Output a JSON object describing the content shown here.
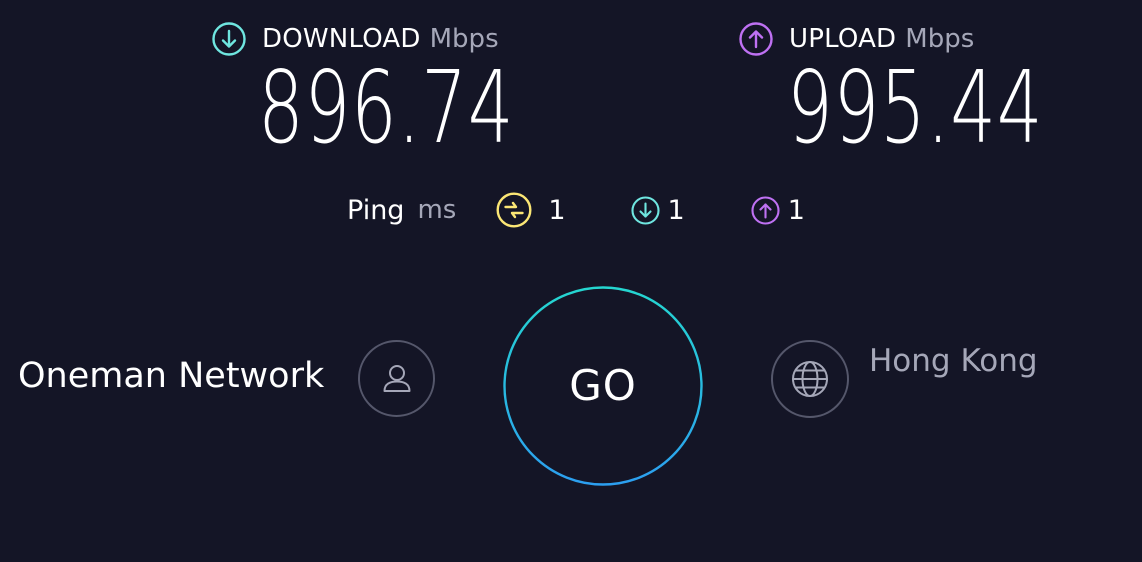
{
  "colors": {
    "background": "#141526",
    "download_accent": "#6fe6e0",
    "upload_accent": "#bf71f3",
    "ping_idle_accent": "#fbe675",
    "go_ring_start": "#25d6d0",
    "go_ring_end": "#2c9ff0",
    "muted_text": "#a5a7b8",
    "icon_outline": "#55576b"
  },
  "download": {
    "icon": "download-arrow-icon",
    "label": "DOWNLOAD",
    "unit": "Mbps",
    "value": "896.74"
  },
  "upload": {
    "icon": "upload-arrow-icon",
    "label": "UPLOAD",
    "unit": "Mbps",
    "value": "995.44"
  },
  "ping": {
    "label": "Ping",
    "unit": "ms",
    "idle": {
      "icon": "idle-latency-icon",
      "value": "1"
    },
    "download": {
      "icon": "download-latency-icon",
      "value": "1"
    },
    "upload": {
      "icon": "upload-latency-icon",
      "value": "1"
    }
  },
  "provider": {
    "name": "Oneman Network",
    "icon": "person-icon"
  },
  "go_button": {
    "label": "GO"
  },
  "server": {
    "name": "Hong Kong",
    "icon": "globe-icon"
  }
}
